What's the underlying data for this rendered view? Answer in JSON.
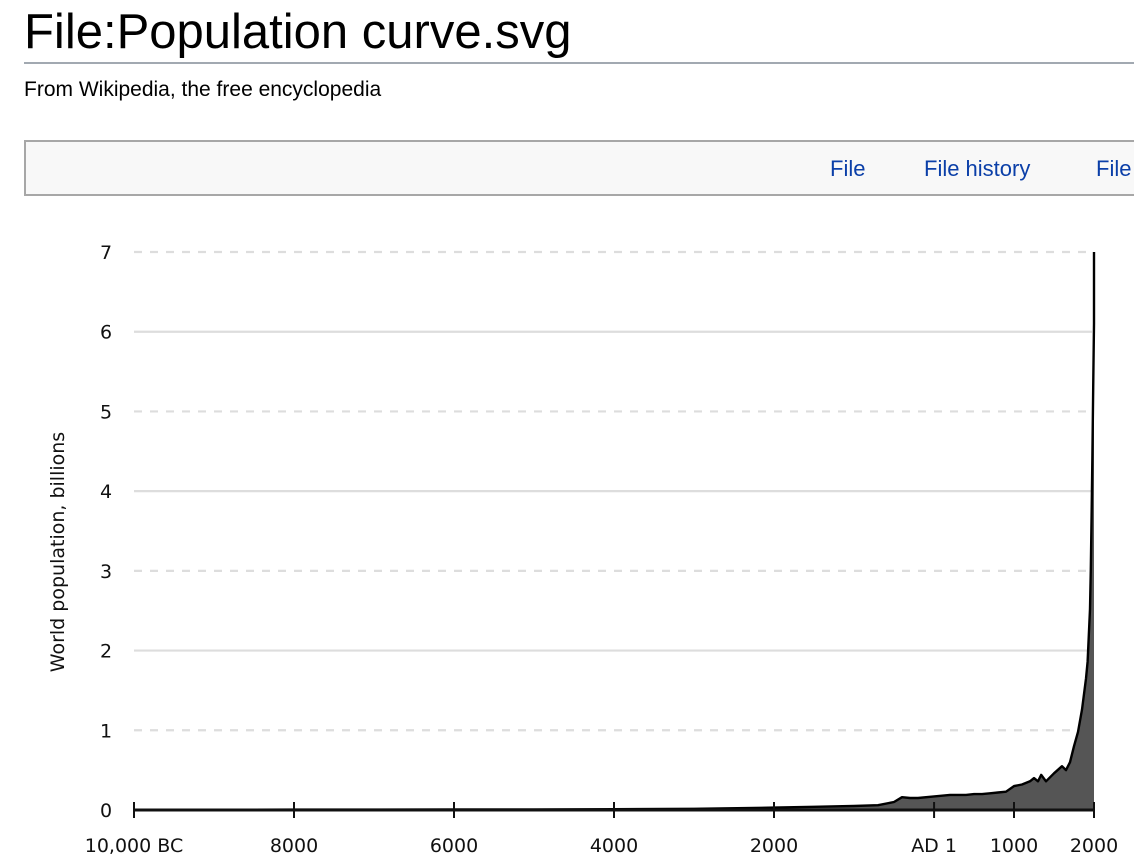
{
  "page": {
    "title": "File:Population curve.svg",
    "tagline": "From Wikipedia, the free encyclopedia"
  },
  "tabs": [
    {
      "label": "File"
    },
    {
      "label": "File history"
    },
    {
      "label": "File"
    }
  ],
  "colors": {
    "link": "#0b3fa8",
    "area_fill": "#555555",
    "line": "#000000",
    "grid": "#dddddd"
  },
  "chart_data": {
    "type": "area",
    "title": "",
    "xlabel": "",
    "ylabel": "World population, billions",
    "xlim": [
      -10000,
      2000
    ],
    "ylim": [
      0,
      7
    ],
    "grid": true,
    "x_ticks": [
      {
        "value": -10000,
        "label": "10,000 BC"
      },
      {
        "value": -8000,
        "label": "8000"
      },
      {
        "value": -6000,
        "label": "6000"
      },
      {
        "value": -4000,
        "label": "4000"
      },
      {
        "value": -2000,
        "label": "2000"
      },
      {
        "value": 1,
        "label": "AD 1"
      },
      {
        "value": 1000,
        "label": "1000"
      },
      {
        "value": 2000,
        "label": "2000"
      }
    ],
    "y_ticks": [
      {
        "value": 0,
        "label": "0"
      },
      {
        "value": 1,
        "label": "1"
      },
      {
        "value": 2,
        "label": "2"
      },
      {
        "value": 3,
        "label": "3"
      },
      {
        "value": 4,
        "label": "4"
      },
      {
        "value": 5,
        "label": "5"
      },
      {
        "value": 6,
        "label": "6"
      },
      {
        "value": 7,
        "label": "7"
      }
    ],
    "series": [
      {
        "name": "World population",
        "x": [
          -10000,
          -8000,
          -6000,
          -5000,
          -4000,
          -3000,
          -2000,
          -1500,
          -1000,
          -700,
          -500,
          -400,
          -300,
          -200,
          1,
          200,
          400,
          500,
          600,
          700,
          800,
          900,
          1000,
          1100,
          1200,
          1250,
          1300,
          1340,
          1400,
          1500,
          1600,
          1650,
          1700,
          1750,
          1800,
          1850,
          1900,
          1920,
          1940,
          1950,
          1960,
          1970,
          1980,
          1990,
          2000,
          2011
        ],
        "values": [
          0.002,
          0.005,
          0.006,
          0.008,
          0.01,
          0.015,
          0.03,
          0.04,
          0.05,
          0.06,
          0.1,
          0.16,
          0.15,
          0.15,
          0.17,
          0.19,
          0.19,
          0.2,
          0.2,
          0.21,
          0.22,
          0.23,
          0.3,
          0.32,
          0.36,
          0.4,
          0.36,
          0.44,
          0.36,
          0.46,
          0.55,
          0.5,
          0.6,
          0.8,
          0.98,
          1.26,
          1.65,
          1.86,
          2.3,
          2.52,
          3.02,
          3.7,
          4.45,
          5.3,
          6.1,
          7.0
        ]
      }
    ]
  }
}
